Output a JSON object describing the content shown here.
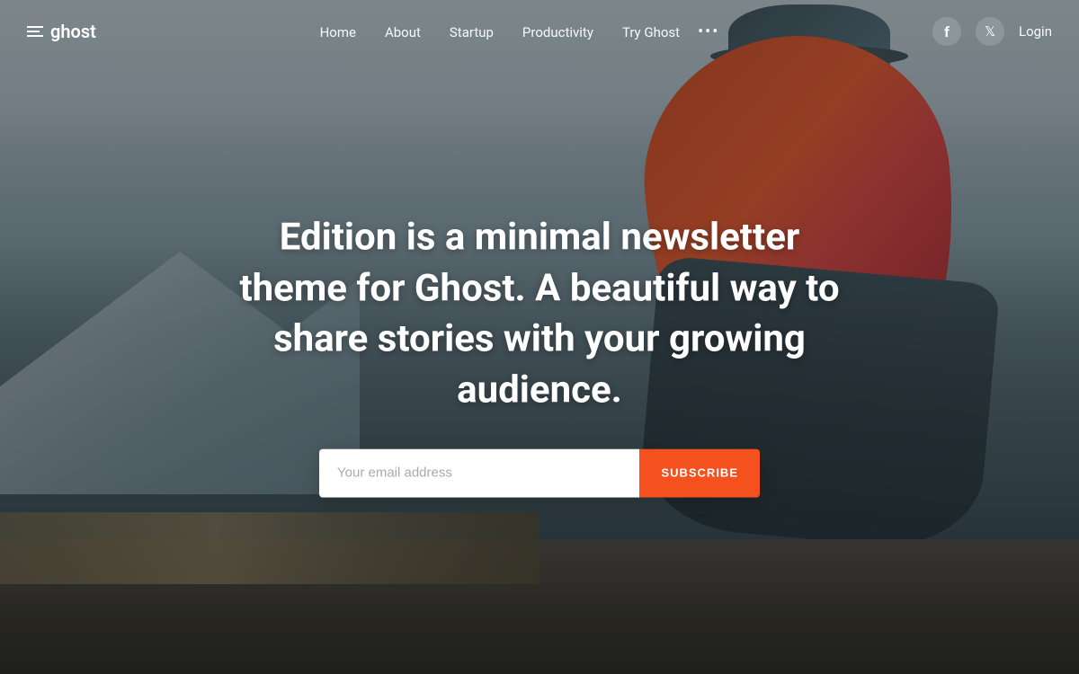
{
  "logo": {
    "text": "ghost",
    "icon_name": "grid-icon"
  },
  "nav": {
    "links": [
      {
        "label": "Home",
        "id": "home"
      },
      {
        "label": "About",
        "id": "about"
      },
      {
        "label": "Startup",
        "id": "startup"
      },
      {
        "label": "Productivity",
        "id": "productivity"
      },
      {
        "label": "Try Ghost",
        "id": "try-ghost"
      }
    ],
    "more_label": "•••",
    "login_label": "Login",
    "facebook_icon": "f",
    "twitter_icon": "𝕏"
  },
  "hero": {
    "title": "Edition is a minimal newsletter theme for Ghost. A beautiful way to share stories with your growing audience.",
    "email_placeholder": "Your email address",
    "subscribe_label": "SUBSCRIBE"
  }
}
